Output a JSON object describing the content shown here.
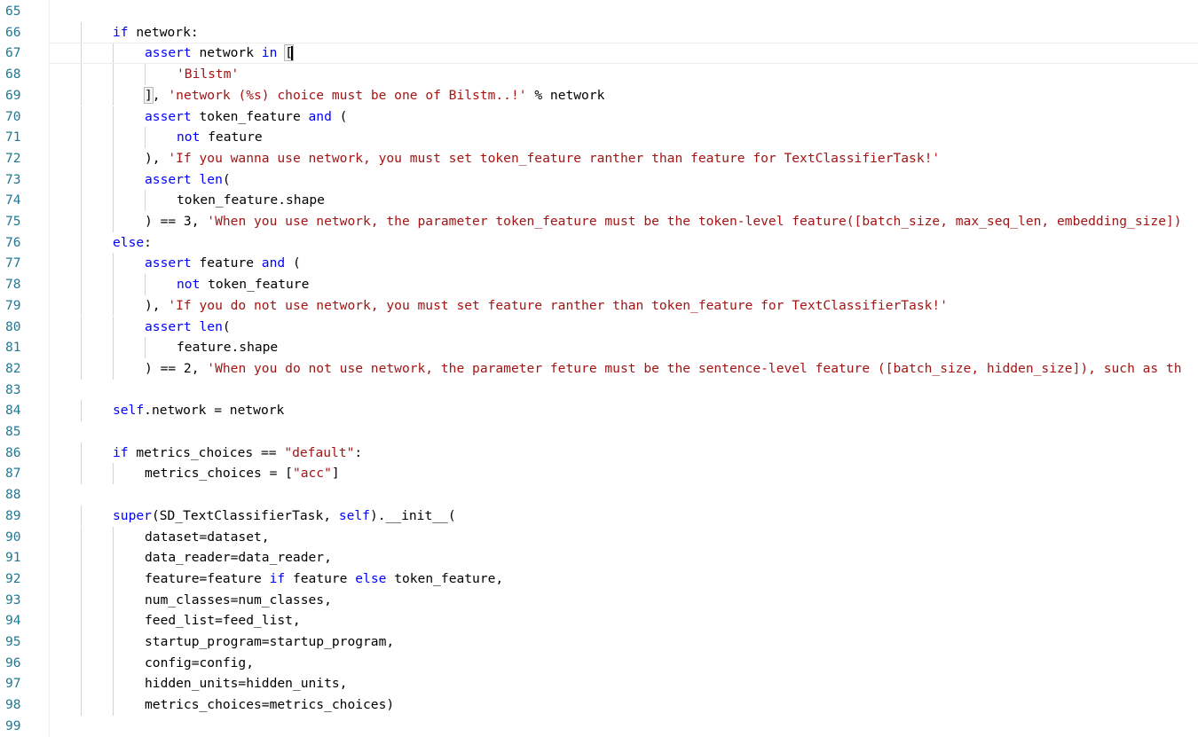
{
  "theme": {
    "background": "#ffffff",
    "line_number_color": "#237893",
    "keyword_color": "#0000ff",
    "string_color": "#a31515",
    "text_color": "#000000",
    "indent_guide_color": "#d3d3d3"
  },
  "editor": {
    "cursor_line": 67,
    "lines": [
      {
        "n": "65",
        "indent": 0,
        "tokens": []
      },
      {
        "n": "66",
        "indent": 2,
        "tokens": [
          [
            "k",
            "if"
          ],
          [
            "t",
            " network:"
          ]
        ]
      },
      {
        "n": "67",
        "indent": 3,
        "tokens": [
          [
            "k",
            "assert"
          ],
          [
            "t",
            " network "
          ],
          [
            "k",
            "in"
          ],
          [
            "t",
            " "
          ],
          [
            "b",
            "["
          ]
        ]
      },
      {
        "n": "68",
        "indent": 4,
        "tokens": [
          [
            "s",
            "'Bilstm'"
          ]
        ]
      },
      {
        "n": "69",
        "indent": 3,
        "tokens": [
          [
            "b",
            "]"
          ],
          [
            "t",
            ", "
          ],
          [
            "s",
            "'network (%s) choice must be one of Bilstm..!'"
          ],
          [
            "t",
            " % network"
          ]
        ]
      },
      {
        "n": "70",
        "indent": 3,
        "tokens": [
          [
            "k",
            "assert"
          ],
          [
            "t",
            " token_feature "
          ],
          [
            "k",
            "and"
          ],
          [
            "t",
            " ("
          ]
        ]
      },
      {
        "n": "71",
        "indent": 4,
        "tokens": [
          [
            "k",
            "not"
          ],
          [
            "t",
            " feature"
          ]
        ]
      },
      {
        "n": "72",
        "indent": 3,
        "tokens": [
          [
            "t",
            "), "
          ],
          [
            "s",
            "'If you wanna use network, you must set token_feature ranther than feature for TextClassifierTask!'"
          ]
        ]
      },
      {
        "n": "73",
        "indent": 3,
        "tokens": [
          [
            "k",
            "assert"
          ],
          [
            "t",
            " "
          ],
          [
            "k",
            "len"
          ],
          [
            "t",
            "("
          ]
        ]
      },
      {
        "n": "74",
        "indent": 4,
        "tokens": [
          [
            "t",
            "token_feature.shape"
          ]
        ]
      },
      {
        "n": "75",
        "indent": 3,
        "tokens": [
          [
            "t",
            ") == 3, "
          ],
          [
            "s",
            "'When you use network, the parameter token_feature must be the token-level feature([batch_size, max_seq_len, embedding_size])"
          ]
        ]
      },
      {
        "n": "76",
        "indent": 2,
        "tokens": [
          [
            "k",
            "else"
          ],
          [
            "t",
            ":"
          ]
        ]
      },
      {
        "n": "77",
        "indent": 3,
        "tokens": [
          [
            "k",
            "assert"
          ],
          [
            "t",
            " feature "
          ],
          [
            "k",
            "and"
          ],
          [
            "t",
            " ("
          ]
        ]
      },
      {
        "n": "78",
        "indent": 4,
        "tokens": [
          [
            "k",
            "not"
          ],
          [
            "t",
            " token_feature"
          ]
        ]
      },
      {
        "n": "79",
        "indent": 3,
        "tokens": [
          [
            "t",
            "), "
          ],
          [
            "s",
            "'If you do not use network, you must set feature ranther than token_feature for TextClassifierTask!'"
          ]
        ]
      },
      {
        "n": "80",
        "indent": 3,
        "tokens": [
          [
            "k",
            "assert"
          ],
          [
            "t",
            " "
          ],
          [
            "k",
            "len"
          ],
          [
            "t",
            "("
          ]
        ]
      },
      {
        "n": "81",
        "indent": 4,
        "tokens": [
          [
            "t",
            "feature.shape"
          ]
        ]
      },
      {
        "n": "82",
        "indent": 3,
        "tokens": [
          [
            "t",
            ") == 2, "
          ],
          [
            "s",
            "'When you do not use network, the parameter feture must be the sentence-level feature ([batch_size, hidden_size]), such as th"
          ]
        ]
      },
      {
        "n": "83",
        "indent": 0,
        "tokens": []
      },
      {
        "n": "84",
        "indent": 2,
        "tokens": [
          [
            "k",
            "self"
          ],
          [
            "t",
            ".network = network"
          ]
        ]
      },
      {
        "n": "85",
        "indent": 0,
        "tokens": []
      },
      {
        "n": "86",
        "indent": 2,
        "tokens": [
          [
            "k",
            "if"
          ],
          [
            "t",
            " metrics_choices == "
          ],
          [
            "s",
            "\"default\""
          ],
          [
            "t",
            ":"
          ]
        ]
      },
      {
        "n": "87",
        "indent": 3,
        "tokens": [
          [
            "t",
            "metrics_choices = ["
          ],
          [
            "s",
            "\"acc\""
          ],
          [
            "t",
            "]"
          ]
        ]
      },
      {
        "n": "88",
        "indent": 0,
        "tokens": []
      },
      {
        "n": "89",
        "indent": 2,
        "tokens": [
          [
            "k",
            "super"
          ],
          [
            "t",
            "(SD_TextClassifierTask, "
          ],
          [
            "k",
            "self"
          ],
          [
            "t",
            ").__init__("
          ]
        ]
      },
      {
        "n": "90",
        "indent": 3,
        "tokens": [
          [
            "t",
            "dataset=dataset,"
          ]
        ]
      },
      {
        "n": "91",
        "indent": 3,
        "tokens": [
          [
            "t",
            "data_reader=data_reader,"
          ]
        ]
      },
      {
        "n": "92",
        "indent": 3,
        "tokens": [
          [
            "t",
            "feature=feature "
          ],
          [
            "k",
            "if"
          ],
          [
            "t",
            " feature "
          ],
          [
            "k",
            "else"
          ],
          [
            "t",
            " token_feature,"
          ]
        ]
      },
      {
        "n": "93",
        "indent": 3,
        "tokens": [
          [
            "t",
            "num_classes=num_classes,"
          ]
        ]
      },
      {
        "n": "94",
        "indent": 3,
        "tokens": [
          [
            "t",
            "feed_list=feed_list,"
          ]
        ]
      },
      {
        "n": "95",
        "indent": 3,
        "tokens": [
          [
            "t",
            "startup_program=startup_program,"
          ]
        ]
      },
      {
        "n": "96",
        "indent": 3,
        "tokens": [
          [
            "t",
            "config=config,"
          ]
        ]
      },
      {
        "n": "97",
        "indent": 3,
        "tokens": [
          [
            "t",
            "hidden_units=hidden_units,"
          ]
        ]
      },
      {
        "n": "98",
        "indent": 3,
        "tokens": [
          [
            "t",
            "metrics_choices=metrics_choices)"
          ]
        ]
      },
      {
        "n": "99",
        "indent": 0,
        "tokens": []
      }
    ]
  }
}
